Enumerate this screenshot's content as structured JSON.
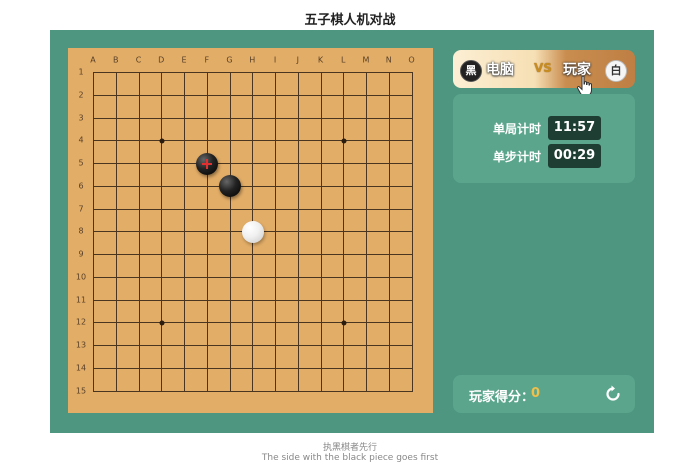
{
  "page_title": "五子棋人机对战",
  "board": {
    "columns": [
      "A",
      "B",
      "C",
      "D",
      "E",
      "F",
      "G",
      "H",
      "I",
      "J",
      "K",
      "L",
      "M",
      "N",
      "O"
    ],
    "rows": [
      "1",
      "2",
      "3",
      "4",
      "5",
      "6",
      "7",
      "8",
      "9",
      "10",
      "11",
      "12",
      "13",
      "14",
      "15"
    ],
    "star_points": [
      [
        "D",
        4
      ],
      [
        "L",
        4
      ],
      [
        "D",
        12
      ],
      [
        "L",
        12
      ]
    ],
    "stones": [
      {
        "color": "black",
        "col": "F",
        "row": 5,
        "last_move": true
      },
      {
        "color": "black",
        "col": "G",
        "row": 6,
        "last_move": false
      },
      {
        "color": "white",
        "col": "H",
        "row": 8,
        "last_move": false
      }
    ]
  },
  "players": {
    "computer_badge": "黑",
    "computer_name": "电脑",
    "vs": "VS",
    "player_name": "玩家",
    "player_badge": "白"
  },
  "timers": {
    "game_label": "单局计时",
    "game_value": "11:57",
    "step_label": "单步计时",
    "step_value": "00:29"
  },
  "score": {
    "label": "玩家得分：",
    "value": "0"
  },
  "caption": {
    "line1": "执黑棋者先行",
    "line2": "The side with the black piece goes first"
  },
  "colors": {
    "panel": "#4e9680",
    "board": "#e2ad67",
    "timer_box": "#1e3d33"
  }
}
